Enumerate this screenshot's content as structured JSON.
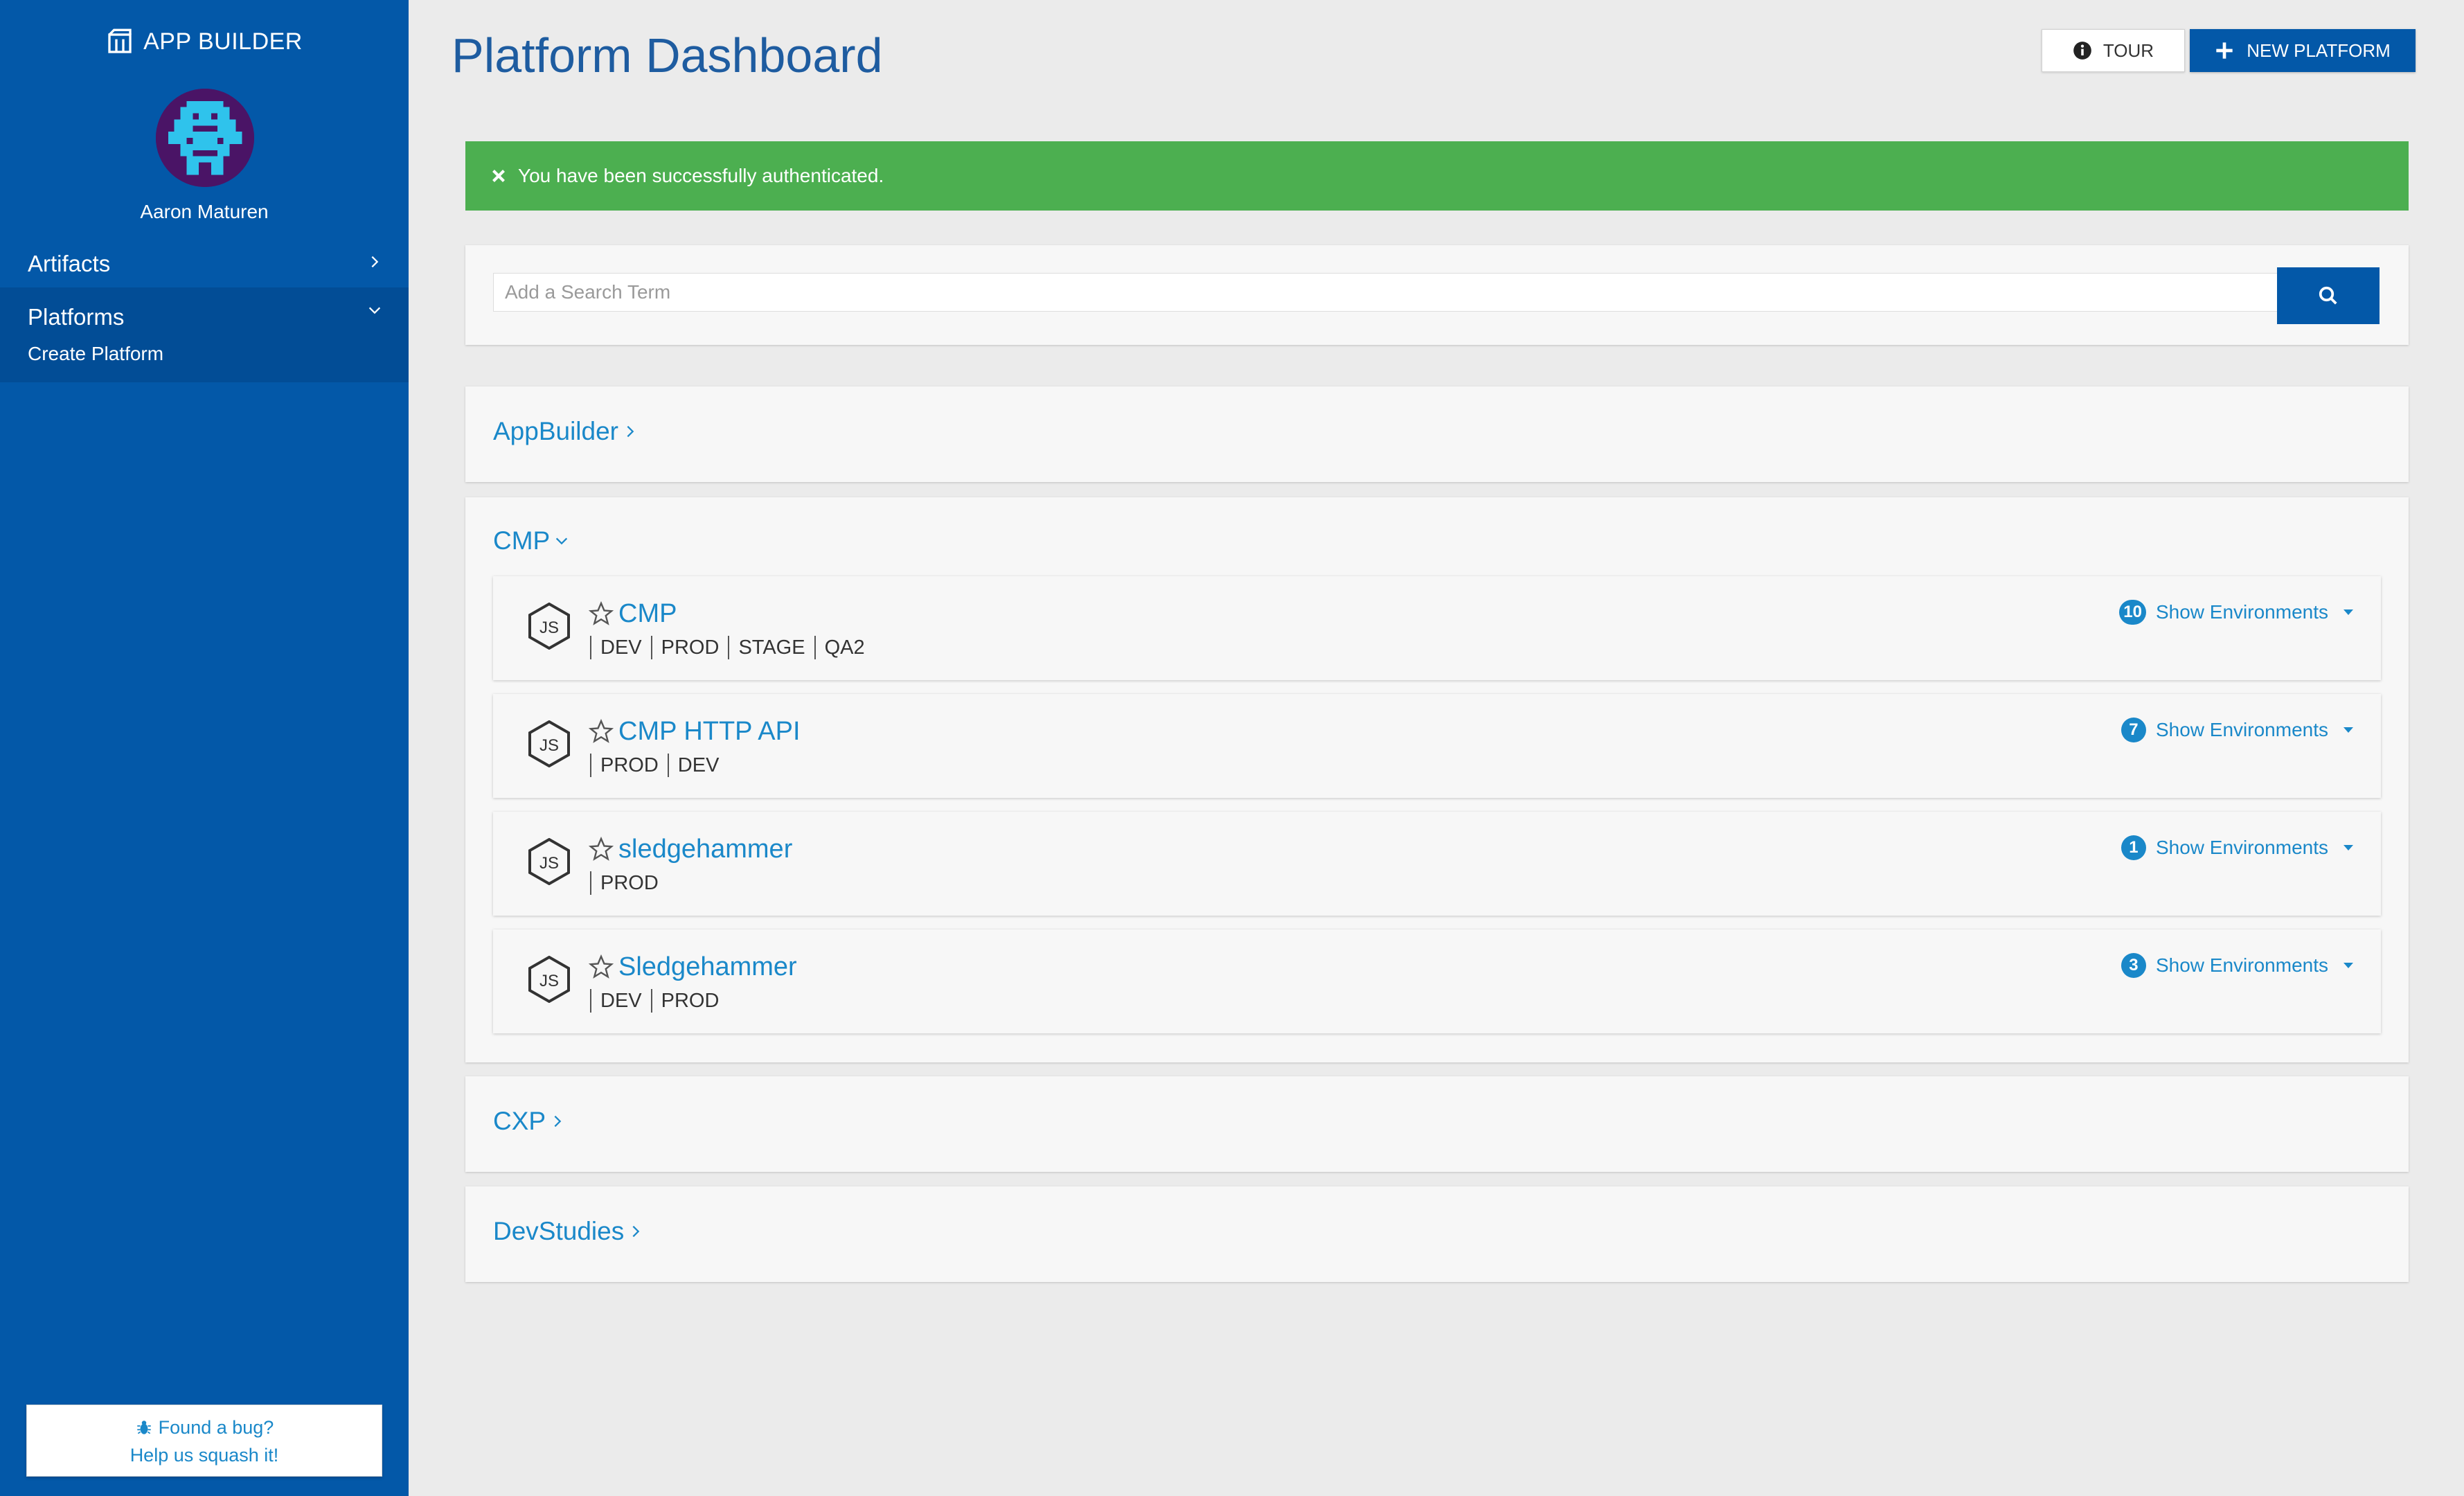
{
  "sidebar": {
    "brand": "APP BUILDER",
    "user_name": "Aaron Maturen",
    "nav": [
      {
        "label": "Artifacts"
      },
      {
        "label": "Platforms",
        "sub": "Create Platform"
      }
    ],
    "bug_line1": "Found a bug?",
    "bug_line2": "Help us squash it!"
  },
  "header": {
    "title": "Platform Dashboard",
    "tour_label": "TOUR",
    "new_platform_label": "NEW PLATFORM"
  },
  "alert": {
    "message": "You have been successfully authenticated."
  },
  "search": {
    "placeholder": "Add a Search Term",
    "value": ""
  },
  "groups": [
    {
      "name": "AppBuilder",
      "expanded": false
    },
    {
      "name": "CMP",
      "expanded": true,
      "platforms": [
        {
          "name": "CMP",
          "envs": [
            "DEV",
            "PROD",
            "STAGE",
            "QA2"
          ],
          "env_count": "10",
          "show_label": "Show Environments"
        },
        {
          "name": "CMP HTTP API",
          "envs": [
            "PROD",
            "DEV"
          ],
          "env_count": "7",
          "show_label": "Show Environments"
        },
        {
          "name": "sledgehammer",
          "envs": [
            "PROD"
          ],
          "env_count": "1",
          "show_label": "Show Environments"
        },
        {
          "name": "Sledgehammer",
          "envs": [
            "DEV",
            "PROD"
          ],
          "env_count": "3",
          "show_label": "Show Environments"
        }
      ]
    },
    {
      "name": "CXP",
      "expanded": false
    },
    {
      "name": "DevStudies",
      "expanded": false
    }
  ],
  "colors": {
    "sidebar": "#0358a8",
    "accent": "#1a88c9",
    "success": "#4caf50",
    "title": "#1e5ca0",
    "avatar_bg": "#4a1466",
    "avatar_fg": "#2fc3ec"
  },
  "icons": [
    "box-icon",
    "chevron-right-icon",
    "chevron-down-icon",
    "info-icon",
    "plus-icon",
    "close-icon",
    "search-icon",
    "star-icon",
    "nodejs-icon",
    "bug-icon"
  ]
}
